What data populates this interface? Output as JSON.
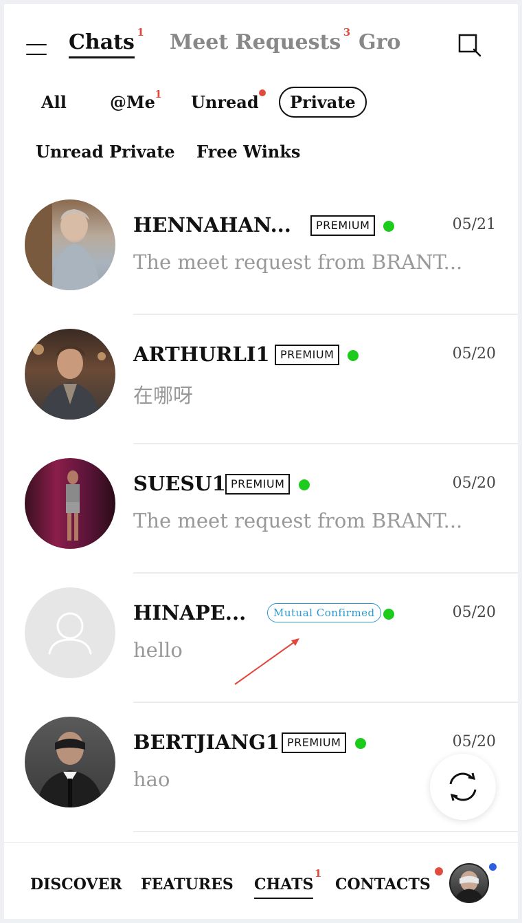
{
  "header": {
    "tabs": [
      {
        "label": "Chats",
        "badge": "1"
      },
      {
        "label": "Meet Requests",
        "badge": "3"
      },
      {
        "label": "Grou",
        "badge": ""
      }
    ],
    "menu_icon": "hamburger-menu-icon",
    "search_icon": "search-icon"
  },
  "filters": {
    "row1": [
      {
        "label": "All",
        "badge": ""
      },
      {
        "label": "@Me",
        "badge": "1"
      },
      {
        "label": "Unread",
        "badge": "dot"
      },
      {
        "label": "Private",
        "badge": "",
        "selected": true
      }
    ],
    "row2": [
      {
        "label": "Unread Private"
      },
      {
        "label": "Free Winks"
      }
    ]
  },
  "chats": [
    {
      "name": "HENNAHAN...",
      "badge": "PREMIUM",
      "online": true,
      "date": "05/21",
      "message": "The meet request from BRANT..."
    },
    {
      "name": "ARTHURLI1",
      "badge": "PREMIUM",
      "online": true,
      "date": "05/20",
      "message": "在哪呀"
    },
    {
      "name": "SUESU1",
      "badge": "PREMIUM",
      "online": true,
      "date": "05/20",
      "message": "The meet request from BRANT..."
    },
    {
      "name": "HINAPE...",
      "badge": "Mutual Confirmed",
      "online": true,
      "date": "05/20",
      "message": "hello"
    },
    {
      "name": "BERTJIANG1",
      "badge": "PREMIUM",
      "online": true,
      "date": "05/20",
      "message": "hao"
    }
  ],
  "floating": {
    "refresh_icon": "refresh-icon"
  },
  "bottom_nav": {
    "items": [
      {
        "label": "DISCOVER",
        "badge": ""
      },
      {
        "label": "FEATURES",
        "badge": ""
      },
      {
        "label": "CHATS",
        "badge": "1"
      },
      {
        "label": "CONTACTS",
        "badge": "dot"
      }
    ]
  },
  "colors": {
    "accent_red": "#e14b3e",
    "online_green": "#1ccb1c",
    "mutual_blue": "#2d97d0",
    "profile_dot_blue": "#2d5fe0",
    "annotation_arrow": "#e0463b"
  }
}
